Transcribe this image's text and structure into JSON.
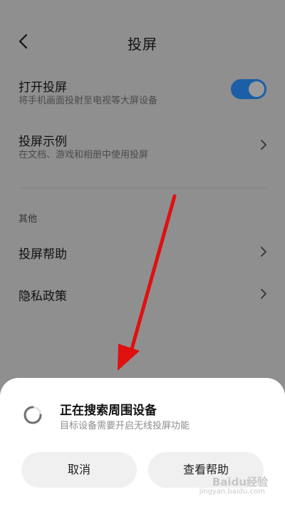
{
  "header": {
    "title": "投屏"
  },
  "settings": {
    "enable_cast": {
      "title": "打开投屏",
      "subtitle": "将手机画面投射至电视等大屏设备",
      "enabled": true
    },
    "cast_examples": {
      "title": "投屏示例",
      "subtitle": "在文档、游戏和相册中使用投屏"
    },
    "section_other": "其他",
    "cast_help": {
      "title": "投屏帮助"
    },
    "privacy_policy": {
      "title": "隐私政策"
    }
  },
  "sheet": {
    "title": "正在搜索周围设备",
    "subtitle": "目标设备需要开启无线投屏功能",
    "cancel_label": "取消",
    "help_label": "查看帮助"
  },
  "watermark": {
    "text": "Baidu经验",
    "sub": "jingyan.baidu.com"
  },
  "colors": {
    "toggle_on": "#1d5fa7",
    "annotation_arrow": "#e01010",
    "sheet_background": "#ffffff"
  },
  "icons": {
    "back": "chevron-left-icon",
    "row_chevron": "chevron-right-icon",
    "spinner": "loading-spinner-icon"
  }
}
